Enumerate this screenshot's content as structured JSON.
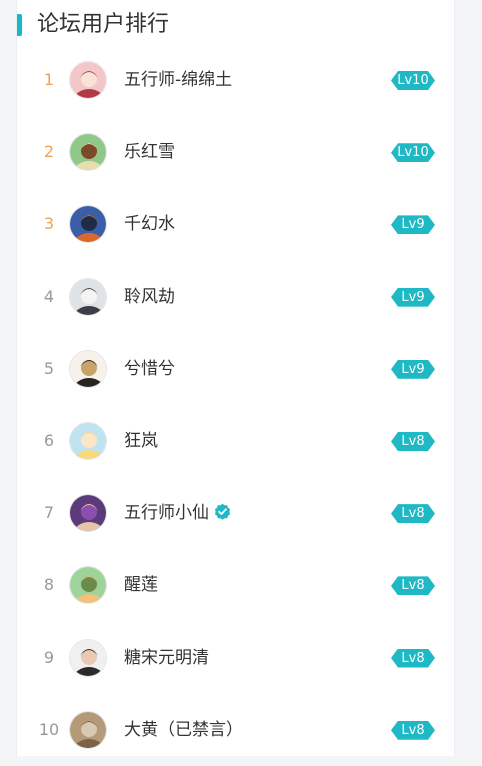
{
  "title": "论坛用户排行",
  "colors": {
    "accent": "#16b9c6",
    "top_rank": "#f4a154",
    "rank": "#999999"
  },
  "users": [
    {
      "rank": "1",
      "name": "五行师-绵绵土",
      "level": "Lv10",
      "verified": false,
      "avatar_colors": [
        "#f3c6c9",
        "#b23a48",
        "#f8e3d6"
      ]
    },
    {
      "rank": "2",
      "name": "乐红雪",
      "level": "Lv10",
      "verified": false,
      "avatar_colors": [
        "#8fc98a",
        "#e9ddb0",
        "#7a4a2a"
      ]
    },
    {
      "rank": "3",
      "name": "千幻水",
      "level": "Lv9",
      "verified": false,
      "avatar_colors": [
        "#3a5fa8",
        "#d96a2b",
        "#1f2c48"
      ]
    },
    {
      "rank": "4",
      "name": "聆风劫",
      "level": "Lv9",
      "verified": false,
      "avatar_colors": [
        "#dfe3e6",
        "#3b3f45",
        "#f4f4f4"
      ]
    },
    {
      "rank": "5",
      "name": "兮惜兮",
      "level": "Lv9",
      "verified": false,
      "avatar_colors": [
        "#f6f1ea",
        "#2a2420",
        "#c8a36a"
      ]
    },
    {
      "rank": "6",
      "name": "狂岚",
      "level": "Lv8",
      "verified": false,
      "avatar_colors": [
        "#bfe3f1",
        "#f6d97a",
        "#fbe6c8"
      ]
    },
    {
      "rank": "7",
      "name": "五行师小仙",
      "level": "Lv8",
      "verified": true,
      "avatar_colors": [
        "#5b3b7a",
        "#e7c4a6",
        "#8b4fb0"
      ]
    },
    {
      "rank": "8",
      "name": "醒莲",
      "level": "Lv8",
      "verified": false,
      "avatar_colors": [
        "#9ed39a",
        "#f2c27b",
        "#6a8c4a"
      ]
    },
    {
      "rank": "9",
      "name": "糖宋元明清",
      "level": "Lv8",
      "verified": false,
      "avatar_colors": [
        "#f0f0f0",
        "#2b2b2b",
        "#e9c9b1"
      ]
    },
    {
      "rank": "10",
      "name": "大黄（已禁言）",
      "level": "Lv8",
      "verified": false,
      "avatar_colors": [
        "#b49a78",
        "#7b6248",
        "#d8c9b0"
      ]
    }
  ]
}
